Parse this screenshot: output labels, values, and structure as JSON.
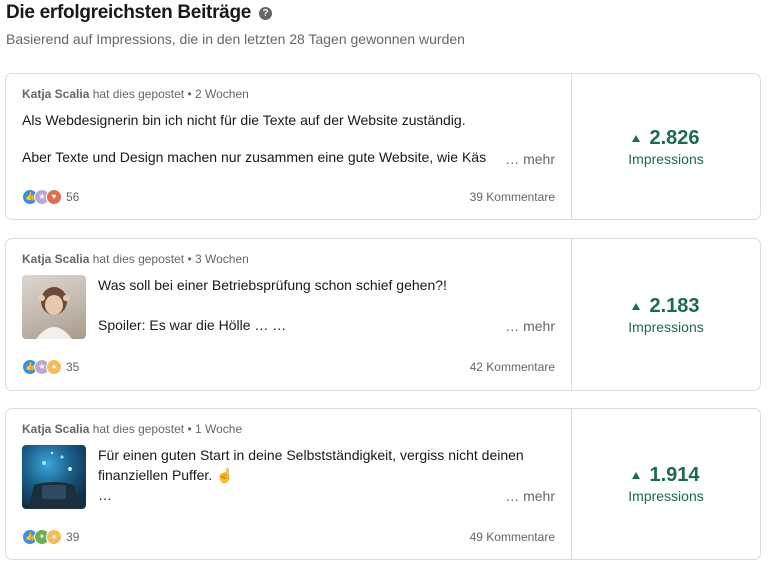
{
  "header": {
    "title": "Die erfolgreichsten Beiträge",
    "help_icon": "?",
    "subtitle": "Basierend auf Impressions, die in den letzten 28 Tagen gewonnen wurden"
  },
  "posts": [
    {
      "author": "Katja Scalia",
      "action": "hat dies gepostet",
      "separator": "•",
      "age": "2 Wochen",
      "line1": "Als Webdesignerin bin ich nicht für die Texte auf der Website zuständig.",
      "line2": "",
      "line3": "Aber Texte und Design machen nur zusammen eine gute Website, wie Käs",
      "more": "… mehr",
      "reactions": [
        "like-icon",
        "support-icon",
        "love-icon"
      ],
      "reaction_count": "56",
      "comments": "39 Kommentare",
      "impressions": "2.826",
      "impressions_label": "Impressions"
    },
    {
      "author": "Katja Scalia",
      "action": "hat dies gepostet",
      "separator": "•",
      "age": "3 Wochen",
      "line1": "Was soll bei einer Betriebsprüfung schon schief gehen?!",
      "line2": "",
      "line3": "Spoiler: Es war die Hölle … …",
      "more": "… mehr",
      "reactions": [
        "like-icon",
        "support-icon",
        "insightful-icon"
      ],
      "reaction_count": "35",
      "comments": "42 Kommentare",
      "impressions": "2.183",
      "impressions_label": "Impressions"
    },
    {
      "author": "Katja Scalia",
      "action": "hat dies gepostet",
      "separator": "•",
      "age": "1 Woche",
      "line1": "Für einen guten Start in deine Selbstständigkeit, vergiss nicht deinen",
      "line2": "finanziellen Puffer. ☝️",
      "line3": "…",
      "more": "… mehr",
      "reactions": [
        "like-icon",
        "celebrate-icon",
        "insightful-icon"
      ],
      "reaction_count": "39",
      "comments": "49 Kommentare",
      "impressions": "1.914",
      "impressions_label": "Impressions"
    }
  ],
  "colors": {
    "accent_green": "#1a6b4f",
    "muted_text": "#666666",
    "border": "#dcdcdc"
  }
}
